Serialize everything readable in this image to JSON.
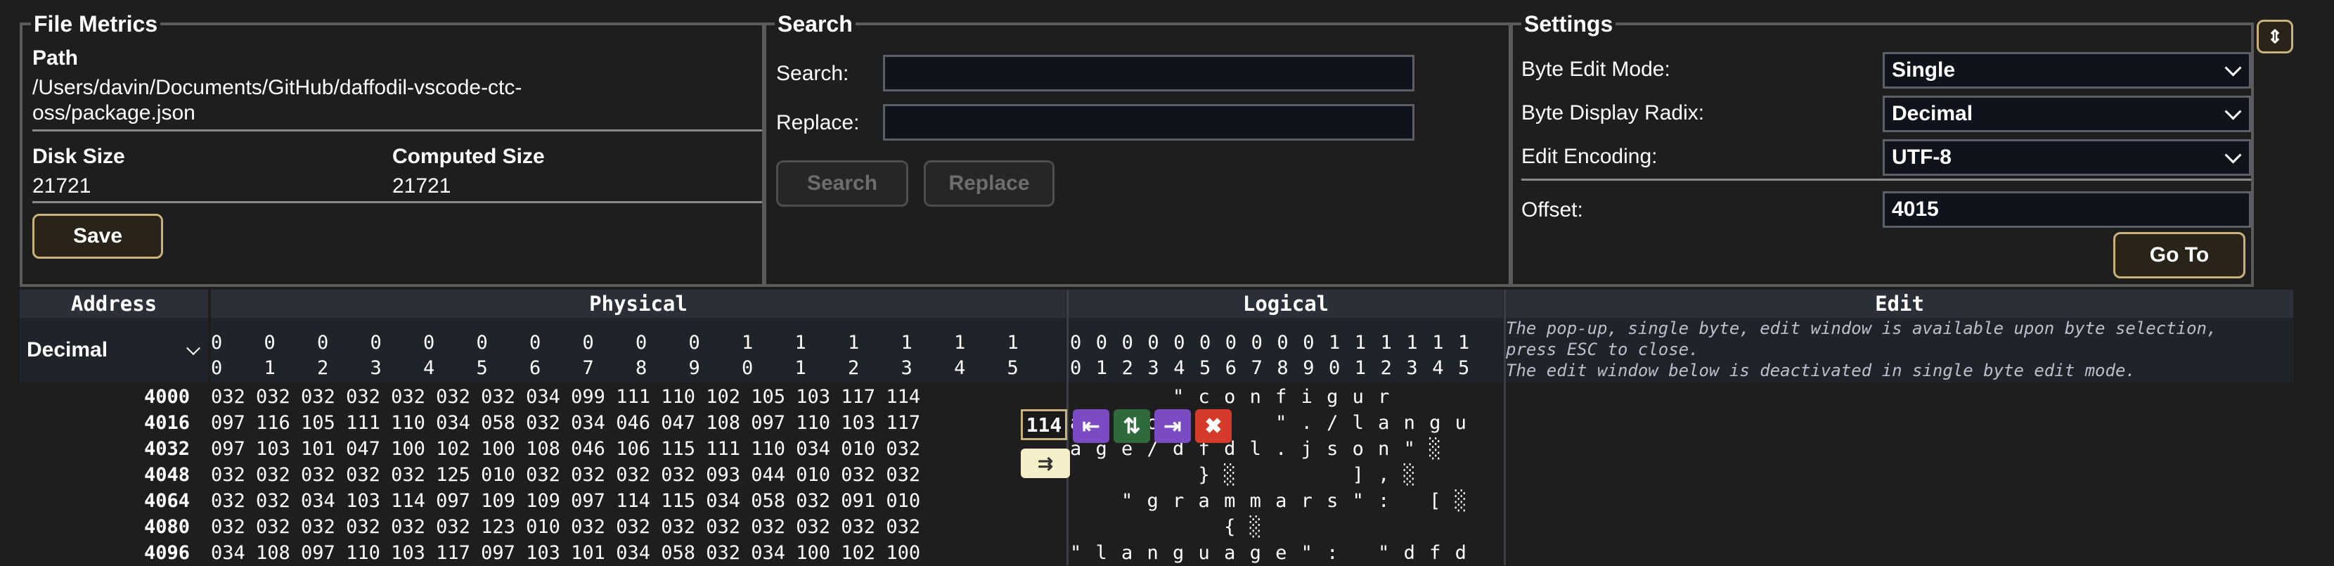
{
  "file_metrics": {
    "title": "File Metrics",
    "path_label": "Path",
    "path_line1": "/Users/davin/Documents/GitHub/daffodil-vscode-ctc-",
    "path_line2": "oss/package.json",
    "disk_size_label": "Disk Size",
    "disk_size_value": "21721",
    "computed_size_label": "Computed Size",
    "computed_size_value": "21721",
    "save_label": "Save"
  },
  "search": {
    "title": "Search",
    "search_label": "Search:",
    "replace_label": "Replace:",
    "search_value": "",
    "replace_value": "",
    "search_button": "Search",
    "replace_button": "Replace"
  },
  "settings": {
    "title": "Settings",
    "byte_edit_mode_label": "Byte Edit Mode:",
    "byte_edit_mode_value": "Single",
    "byte_display_radix_label": "Byte Display Radix:",
    "byte_display_radix_value": "Decimal",
    "edit_encoding_label": "Edit Encoding:",
    "edit_encoding_value": "UTF-8",
    "offset_label": "Offset:",
    "offset_value": "4015",
    "goto_label": "Go To",
    "collapse_icon": "⇕"
  },
  "viewer": {
    "address_header": "Address",
    "physical_header": "Physical",
    "logical_header": "Logical",
    "edit_header": "Edit",
    "address_radix": "Decimal",
    "col_top": [
      "0",
      "0",
      "0",
      "0",
      "0",
      "0",
      "0",
      "0",
      "0",
      "0",
      "1",
      "1",
      "1",
      "1",
      "1",
      "1"
    ],
    "col_bottom": [
      "0",
      "1",
      "2",
      "3",
      "4",
      "5",
      "6",
      "7",
      "8",
      "9",
      "0",
      "1",
      "2",
      "3",
      "4",
      "5"
    ],
    "edit_note_1": "The pop-up, single byte, edit window is available upon byte selection,",
    "edit_note_2": "press ESC to close.",
    "edit_note_3": "The edit window below is deactivated in single byte edit mode.",
    "rows": [
      {
        "addr": "4000",
        "bytes": "032 032 032 032 032 032 032 034 099 111 110 102 105 103 117 114",
        "logical": "        \" c o n f i g u r"
      },
      {
        "addr": "4016",
        "bytes": "097 116 105 111 110 034 058 032 034 046 047 108 097 110 103 117",
        "logical": "a t i o n \" :   \" . / l a n g u"
      },
      {
        "addr": "4032",
        "bytes": "097 103 101 047 100 102 100 108 046 106 115 111 110 034 010 032",
        "logical": "a g e / d f d l . j s o n \" ░"
      },
      {
        "addr": "4048",
        "bytes": "032 032 032 032 032 125 010 032 032 032 032 093 044 010 032 032",
        "logical": "          } ░         ] , ░"
      },
      {
        "addr": "4064",
        "bytes": "032 032 034 103 114 097 109 109 097 114 115 034 058 032 091 010",
        "logical": "    \" g r a m m a r s \" :   [ ░"
      },
      {
        "addr": "4080",
        "bytes": "032 032 032 032 032 032 123 010 032 032 032 032 032 032 032 032",
        "logical": "            { ░"
      },
      {
        "addr": "4096",
        "bytes": "034 108 097 110 103 117 097 103 101 034 058 032 034 100 102 100",
        "logical": "\" l a n g u a g e \" :   \" d f d"
      }
    ]
  },
  "popup": {
    "value": "114",
    "insert_before_icon": "⇤",
    "swap_icon": "⇅",
    "insert_after_icon": "⇥",
    "delete_icon": "✖",
    "commit_icon": "⇉"
  }
}
